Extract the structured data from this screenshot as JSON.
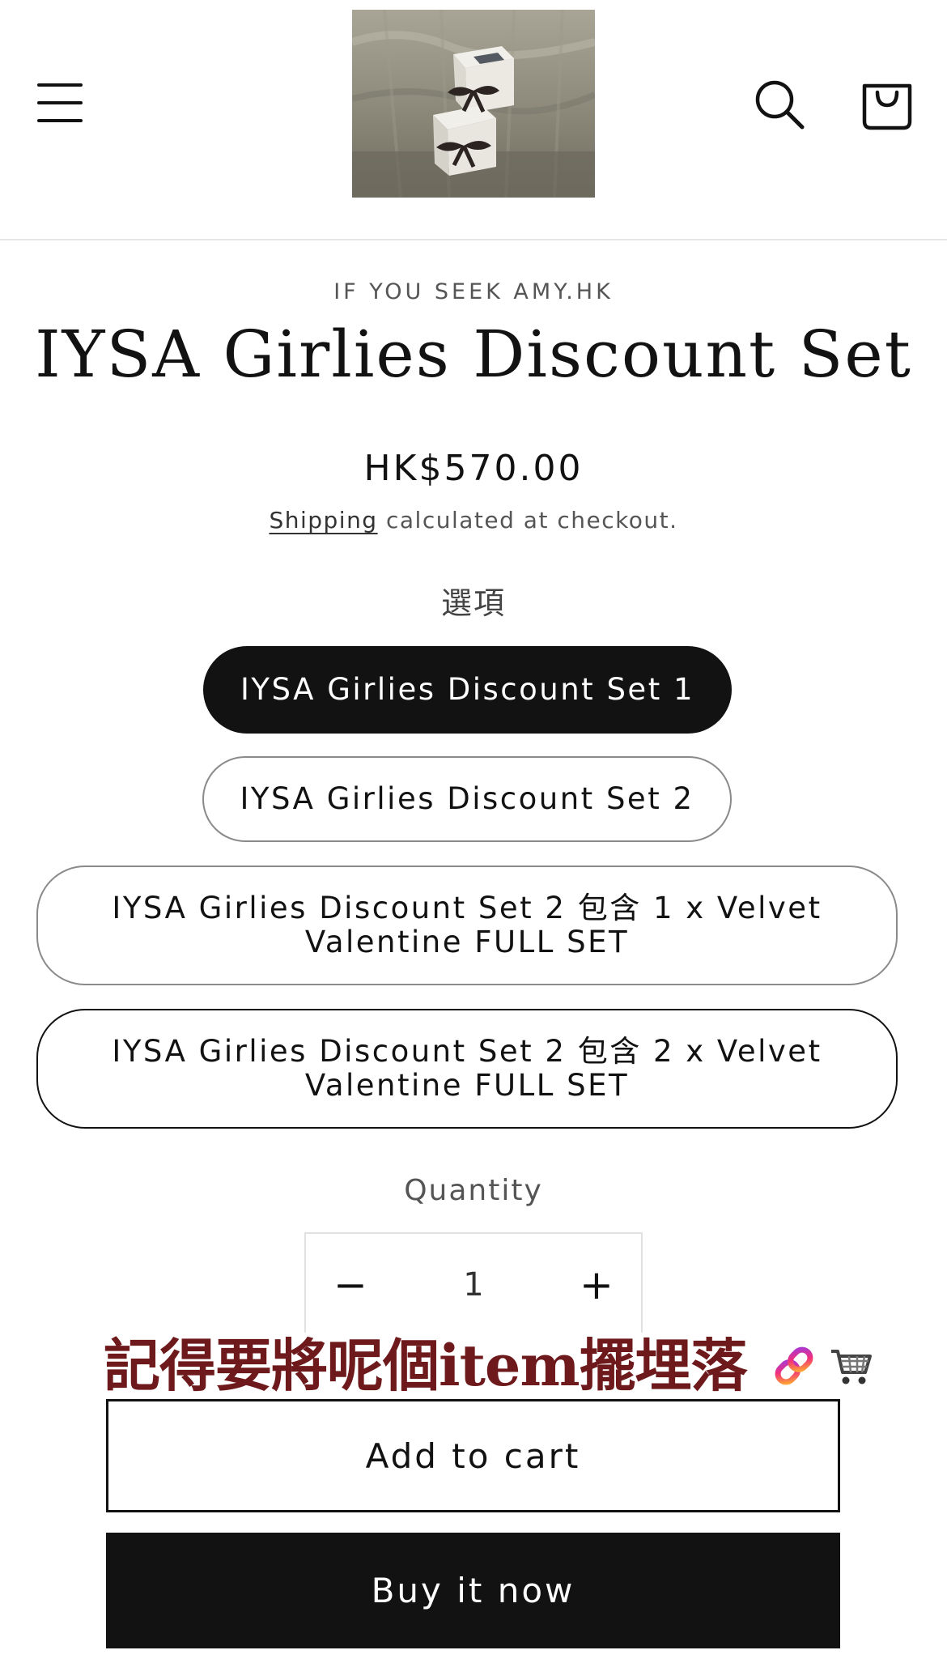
{
  "header": {
    "menu_icon": "hamburger-menu-icon",
    "logo_alt": "gift boxes with ribbons on sofa",
    "search_icon": "search-icon",
    "cart_icon": "shopping-bag-icon"
  },
  "product": {
    "vendor": "IF YOU SEEK AMY.HK",
    "title": "IYSA Girlies Discount Set",
    "price": "HK$570.00",
    "shipping_link": "Shipping",
    "shipping_text": " calculated at checkout."
  },
  "options": {
    "label": "選項",
    "variants": [
      {
        "label": "IYSA Girlies Discount Set 1",
        "selected": true
      },
      {
        "label": "IYSA Girlies Discount Set 2",
        "selected": false
      },
      {
        "label": "IYSA Girlies Discount Set 2 包含 1 x Velvet Valentine FULL SET",
        "selected": false
      },
      {
        "label": "IYSA Girlies Discount Set 2 包含 2 x Velvet Valentine FULL SET",
        "selected": false
      }
    ]
  },
  "quantity": {
    "label": "Quantity",
    "minus": "−",
    "value": "1",
    "plus": "+"
  },
  "sticker": {
    "text": "記得要將呢個item擺埋落",
    "icons": [
      "link-emoji-icon",
      "shopping-cart-emoji-icon"
    ]
  },
  "actions": {
    "add_to_cart": "Add to cart",
    "buy_now": "Buy it now"
  },
  "colors": {
    "primary": "#121212",
    "sticker_text": "#6e1a1c",
    "border_light": "#e1e1e1"
  }
}
